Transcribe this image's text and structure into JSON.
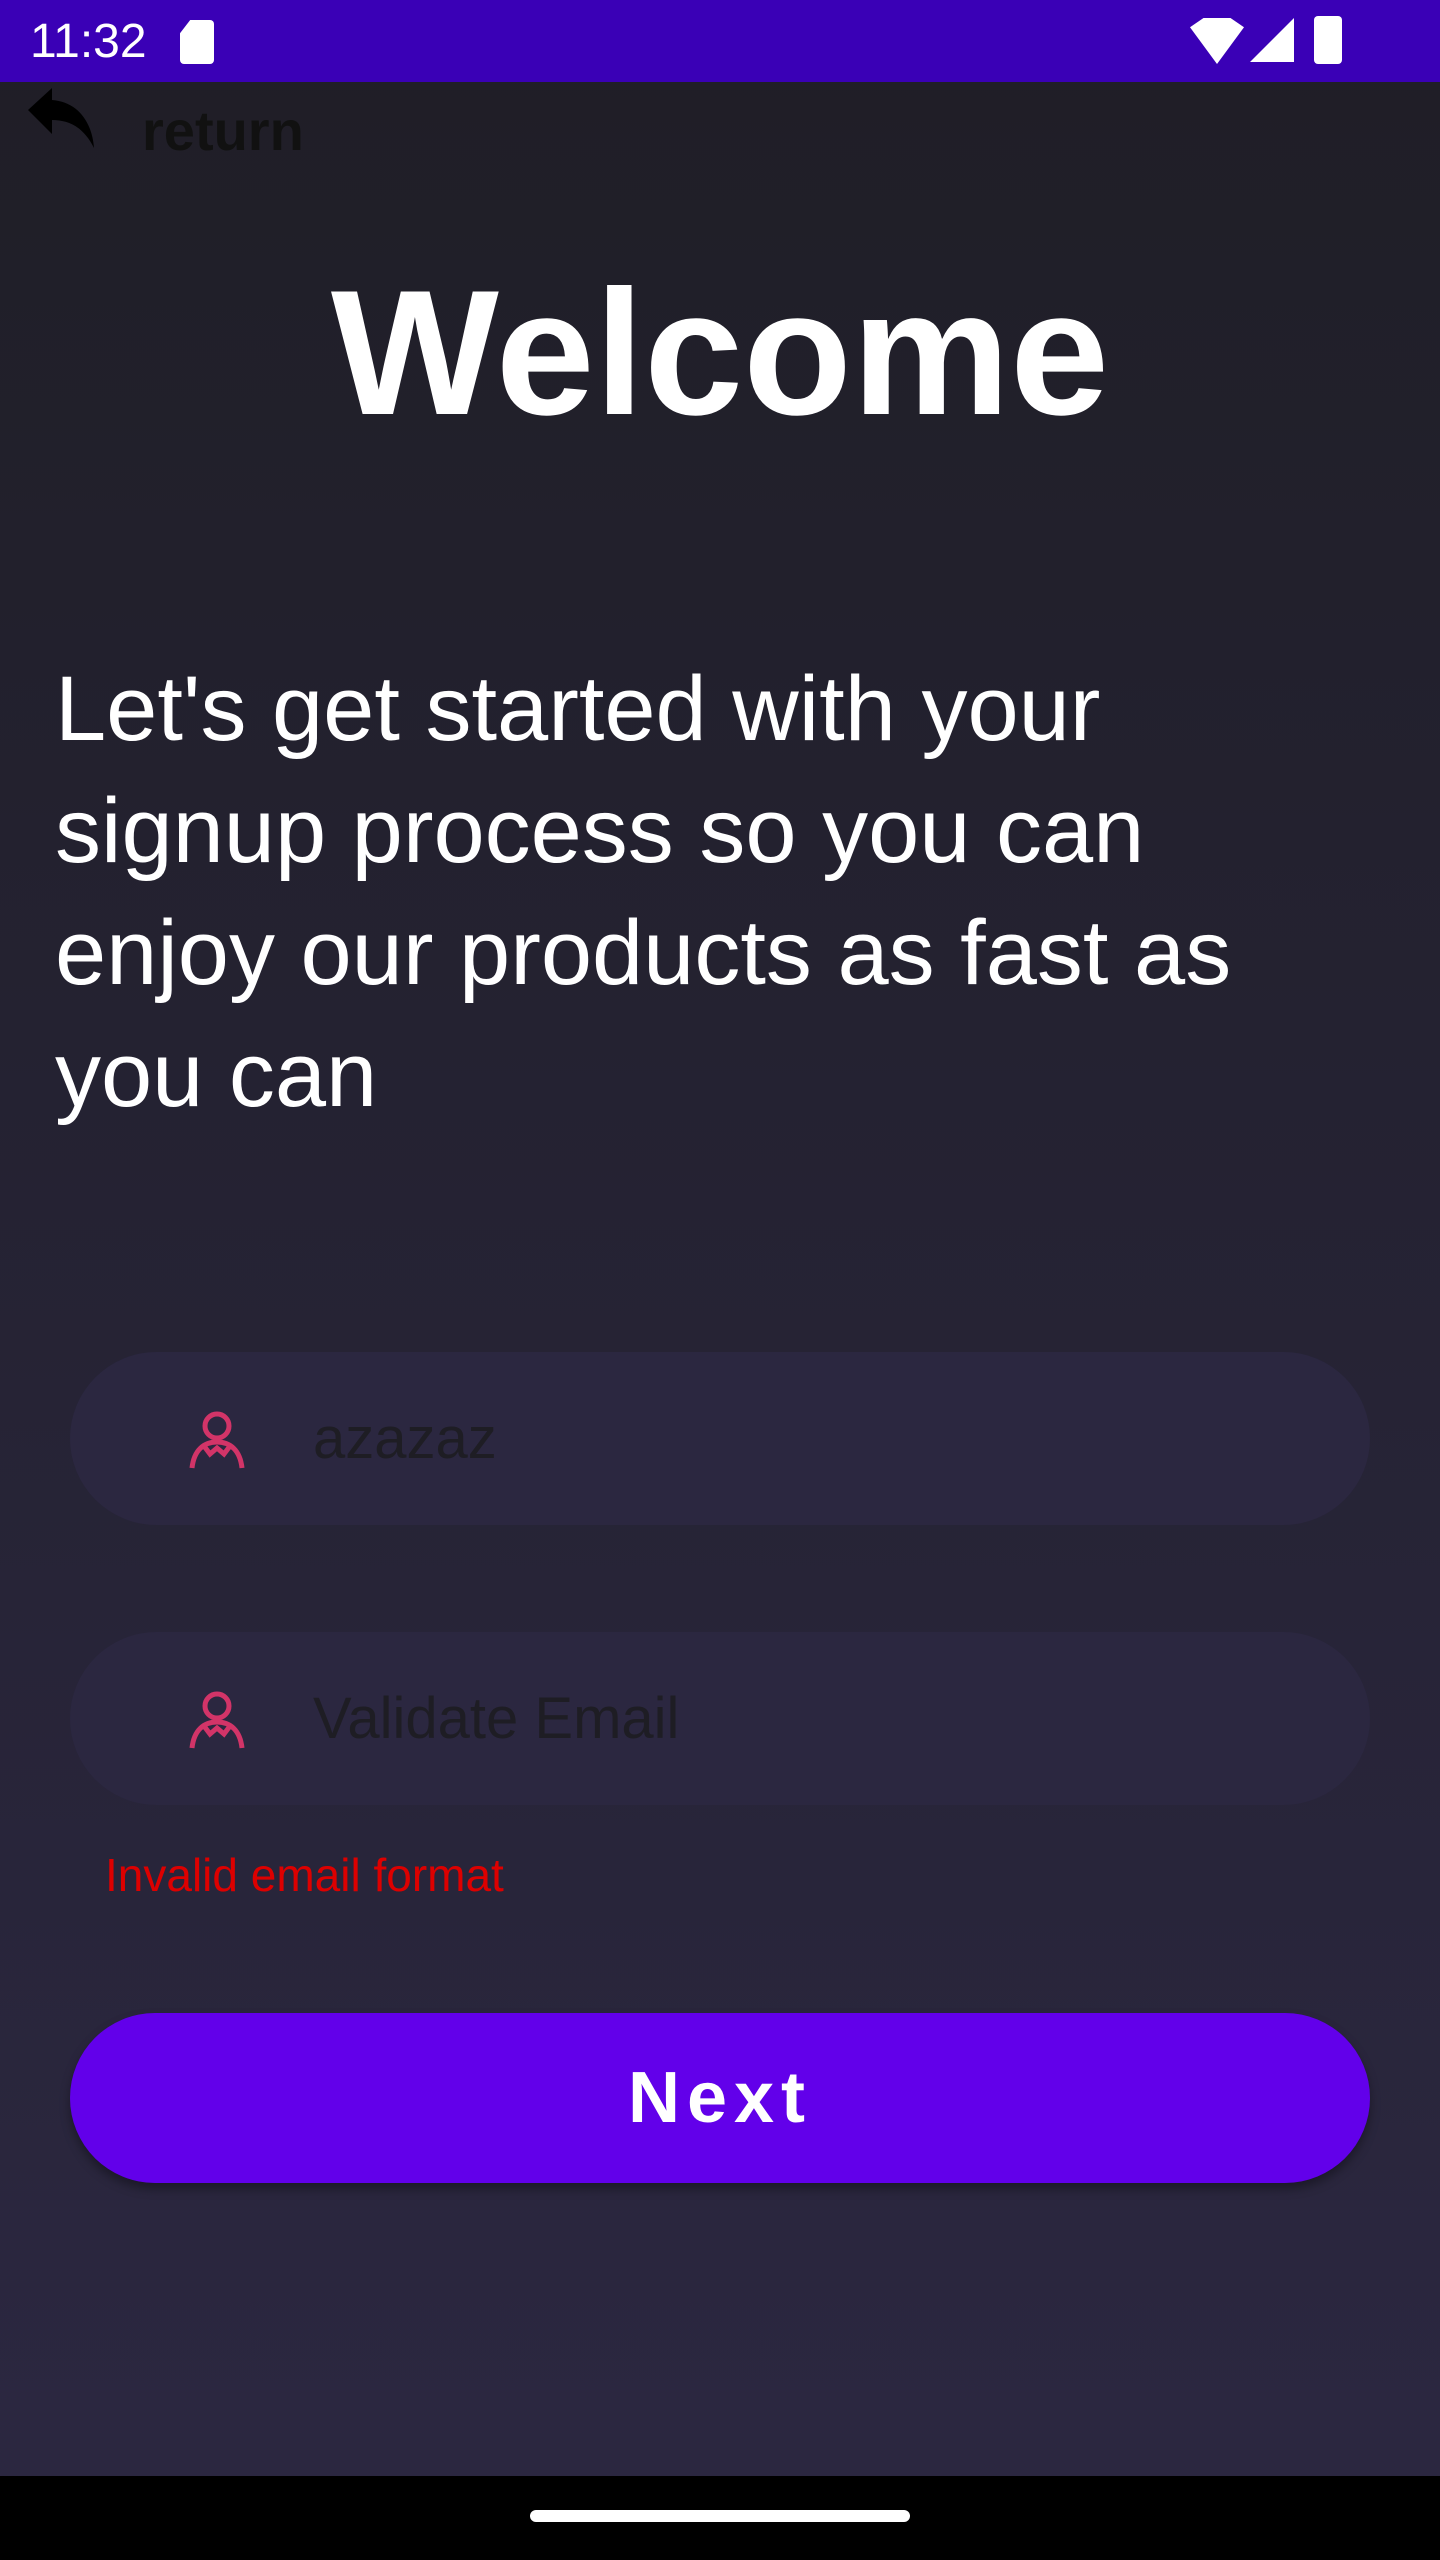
{
  "status_bar": {
    "time": "11:32",
    "icons": [
      "sd-card-icon",
      "wifi-icon",
      "signal-icon",
      "battery-icon"
    ]
  },
  "header": {
    "back_label": "return",
    "back_icon": "reply-arrow-icon"
  },
  "title": "Welcome",
  "intro": "Let's get started with your signup process so you can enjoy our products as fast as you can",
  "form": {
    "name_field": {
      "value": "azazaz",
      "icon": "user-icon"
    },
    "email_field": {
      "value": "",
      "placeholder": "Validate Email",
      "icon": "user-icon"
    },
    "email_error": "Invalid email format",
    "next_label": "Next"
  },
  "colors": {
    "status_bar": "#3a00b6",
    "accent": "#6200ea",
    "error": "#dd0000",
    "icon": "#d23468",
    "field_bg": "#2b2740"
  }
}
